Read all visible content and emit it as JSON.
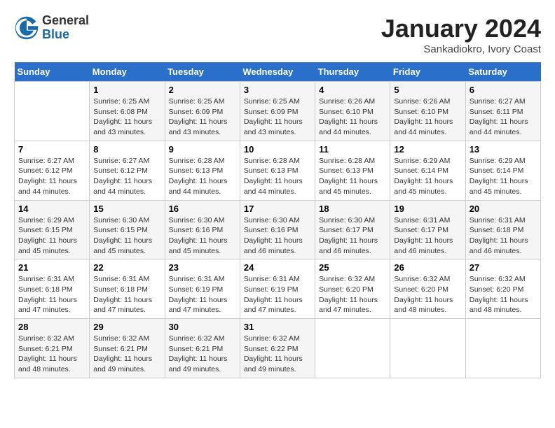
{
  "header": {
    "logo_general": "General",
    "logo_blue": "Blue",
    "month_title": "January 2024",
    "subtitle": "Sankadiokro, Ivory Coast"
  },
  "calendar": {
    "days_of_week": [
      "Sunday",
      "Monday",
      "Tuesday",
      "Wednesday",
      "Thursday",
      "Friday",
      "Saturday"
    ],
    "weeks": [
      [
        {
          "day": "",
          "info": ""
        },
        {
          "day": "1",
          "info": "Sunrise: 6:25 AM\nSunset: 6:08 PM\nDaylight: 11 hours\nand 43 minutes."
        },
        {
          "day": "2",
          "info": "Sunrise: 6:25 AM\nSunset: 6:09 PM\nDaylight: 11 hours\nand 43 minutes."
        },
        {
          "day": "3",
          "info": "Sunrise: 6:25 AM\nSunset: 6:09 PM\nDaylight: 11 hours\nand 43 minutes."
        },
        {
          "day": "4",
          "info": "Sunrise: 6:26 AM\nSunset: 6:10 PM\nDaylight: 11 hours\nand 44 minutes."
        },
        {
          "day": "5",
          "info": "Sunrise: 6:26 AM\nSunset: 6:10 PM\nDaylight: 11 hours\nand 44 minutes."
        },
        {
          "day": "6",
          "info": "Sunrise: 6:27 AM\nSunset: 6:11 PM\nDaylight: 11 hours\nand 44 minutes."
        }
      ],
      [
        {
          "day": "7",
          "info": "Sunrise: 6:27 AM\nSunset: 6:12 PM\nDaylight: 11 hours\nand 44 minutes."
        },
        {
          "day": "8",
          "info": "Sunrise: 6:27 AM\nSunset: 6:12 PM\nDaylight: 11 hours\nand 44 minutes."
        },
        {
          "day": "9",
          "info": "Sunrise: 6:28 AM\nSunset: 6:13 PM\nDaylight: 11 hours\nand 44 minutes."
        },
        {
          "day": "10",
          "info": "Sunrise: 6:28 AM\nSunset: 6:13 PM\nDaylight: 11 hours\nand 44 minutes."
        },
        {
          "day": "11",
          "info": "Sunrise: 6:28 AM\nSunset: 6:13 PM\nDaylight: 11 hours\nand 45 minutes."
        },
        {
          "day": "12",
          "info": "Sunrise: 6:29 AM\nSunset: 6:14 PM\nDaylight: 11 hours\nand 45 minutes."
        },
        {
          "day": "13",
          "info": "Sunrise: 6:29 AM\nSunset: 6:14 PM\nDaylight: 11 hours\nand 45 minutes."
        }
      ],
      [
        {
          "day": "14",
          "info": "Sunrise: 6:29 AM\nSunset: 6:15 PM\nDaylight: 11 hours\nand 45 minutes."
        },
        {
          "day": "15",
          "info": "Sunrise: 6:30 AM\nSunset: 6:15 PM\nDaylight: 11 hours\nand 45 minutes."
        },
        {
          "day": "16",
          "info": "Sunrise: 6:30 AM\nSunset: 6:16 PM\nDaylight: 11 hours\nand 45 minutes."
        },
        {
          "day": "17",
          "info": "Sunrise: 6:30 AM\nSunset: 6:16 PM\nDaylight: 11 hours\nand 46 minutes."
        },
        {
          "day": "18",
          "info": "Sunrise: 6:30 AM\nSunset: 6:17 PM\nDaylight: 11 hours\nand 46 minutes."
        },
        {
          "day": "19",
          "info": "Sunrise: 6:31 AM\nSunset: 6:17 PM\nDaylight: 11 hours\nand 46 minutes."
        },
        {
          "day": "20",
          "info": "Sunrise: 6:31 AM\nSunset: 6:18 PM\nDaylight: 11 hours\nand 46 minutes."
        }
      ],
      [
        {
          "day": "21",
          "info": "Sunrise: 6:31 AM\nSunset: 6:18 PM\nDaylight: 11 hours\nand 47 minutes."
        },
        {
          "day": "22",
          "info": "Sunrise: 6:31 AM\nSunset: 6:18 PM\nDaylight: 11 hours\nand 47 minutes."
        },
        {
          "day": "23",
          "info": "Sunrise: 6:31 AM\nSunset: 6:19 PM\nDaylight: 11 hours\nand 47 minutes."
        },
        {
          "day": "24",
          "info": "Sunrise: 6:31 AM\nSunset: 6:19 PM\nDaylight: 11 hours\nand 47 minutes."
        },
        {
          "day": "25",
          "info": "Sunrise: 6:32 AM\nSunset: 6:20 PM\nDaylight: 11 hours\nand 47 minutes."
        },
        {
          "day": "26",
          "info": "Sunrise: 6:32 AM\nSunset: 6:20 PM\nDaylight: 11 hours\nand 48 minutes."
        },
        {
          "day": "27",
          "info": "Sunrise: 6:32 AM\nSunset: 6:20 PM\nDaylight: 11 hours\nand 48 minutes."
        }
      ],
      [
        {
          "day": "28",
          "info": "Sunrise: 6:32 AM\nSunset: 6:21 PM\nDaylight: 11 hours\nand 48 minutes."
        },
        {
          "day": "29",
          "info": "Sunrise: 6:32 AM\nSunset: 6:21 PM\nDaylight: 11 hours\nand 49 minutes."
        },
        {
          "day": "30",
          "info": "Sunrise: 6:32 AM\nSunset: 6:21 PM\nDaylight: 11 hours\nand 49 minutes."
        },
        {
          "day": "31",
          "info": "Sunrise: 6:32 AM\nSunset: 6:22 PM\nDaylight: 11 hours\nand 49 minutes."
        },
        {
          "day": "",
          "info": ""
        },
        {
          "day": "",
          "info": ""
        },
        {
          "day": "",
          "info": ""
        }
      ]
    ]
  }
}
